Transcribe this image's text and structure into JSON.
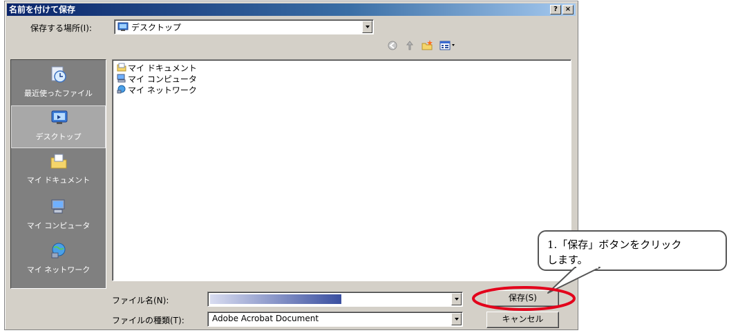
{
  "dialog": {
    "title": "名前を付けて保存",
    "help_button": "?",
    "close_button": "×"
  },
  "save_in": {
    "label": "保存する場所(I):",
    "value": "デスクトップ"
  },
  "toolbar": {
    "icons": [
      "back-icon",
      "up-folder-icon",
      "new-folder-icon",
      "view-menu-icon"
    ]
  },
  "places_bar": [
    {
      "label": "最近使ったファイル",
      "icon": "recent-files-icon"
    },
    {
      "label": "デスクトップ",
      "icon": "desktop-icon",
      "selected": true
    },
    {
      "label": "マイ ドキュメント",
      "icon": "my-documents-icon"
    },
    {
      "label": "マイ コンピュータ",
      "icon": "my-computer-icon"
    },
    {
      "label": "マイ ネットワーク",
      "icon": "my-network-icon"
    }
  ],
  "file_list": [
    {
      "name": "マイ ドキュメント",
      "icon": "folder-icon"
    },
    {
      "name": "マイ コンピュータ",
      "icon": "computer-icon"
    },
    {
      "name": "マイ ネットワーク",
      "icon": "network-icon"
    }
  ],
  "file_name": {
    "label": "ファイル名(N):",
    "value": ""
  },
  "file_type": {
    "label": "ファイルの種類(T):",
    "value": "Adobe Acrobat Document"
  },
  "buttons": {
    "save": "保存(S)",
    "cancel": "キャンセル"
  },
  "callout": {
    "line1": "1.「保存」ボタンをクリック",
    "line2": "します。"
  },
  "colors": {
    "title_bar": "#0a246a",
    "dialog_face": "#d4d0c8",
    "highlight_ellipse": "#e3001b"
  }
}
